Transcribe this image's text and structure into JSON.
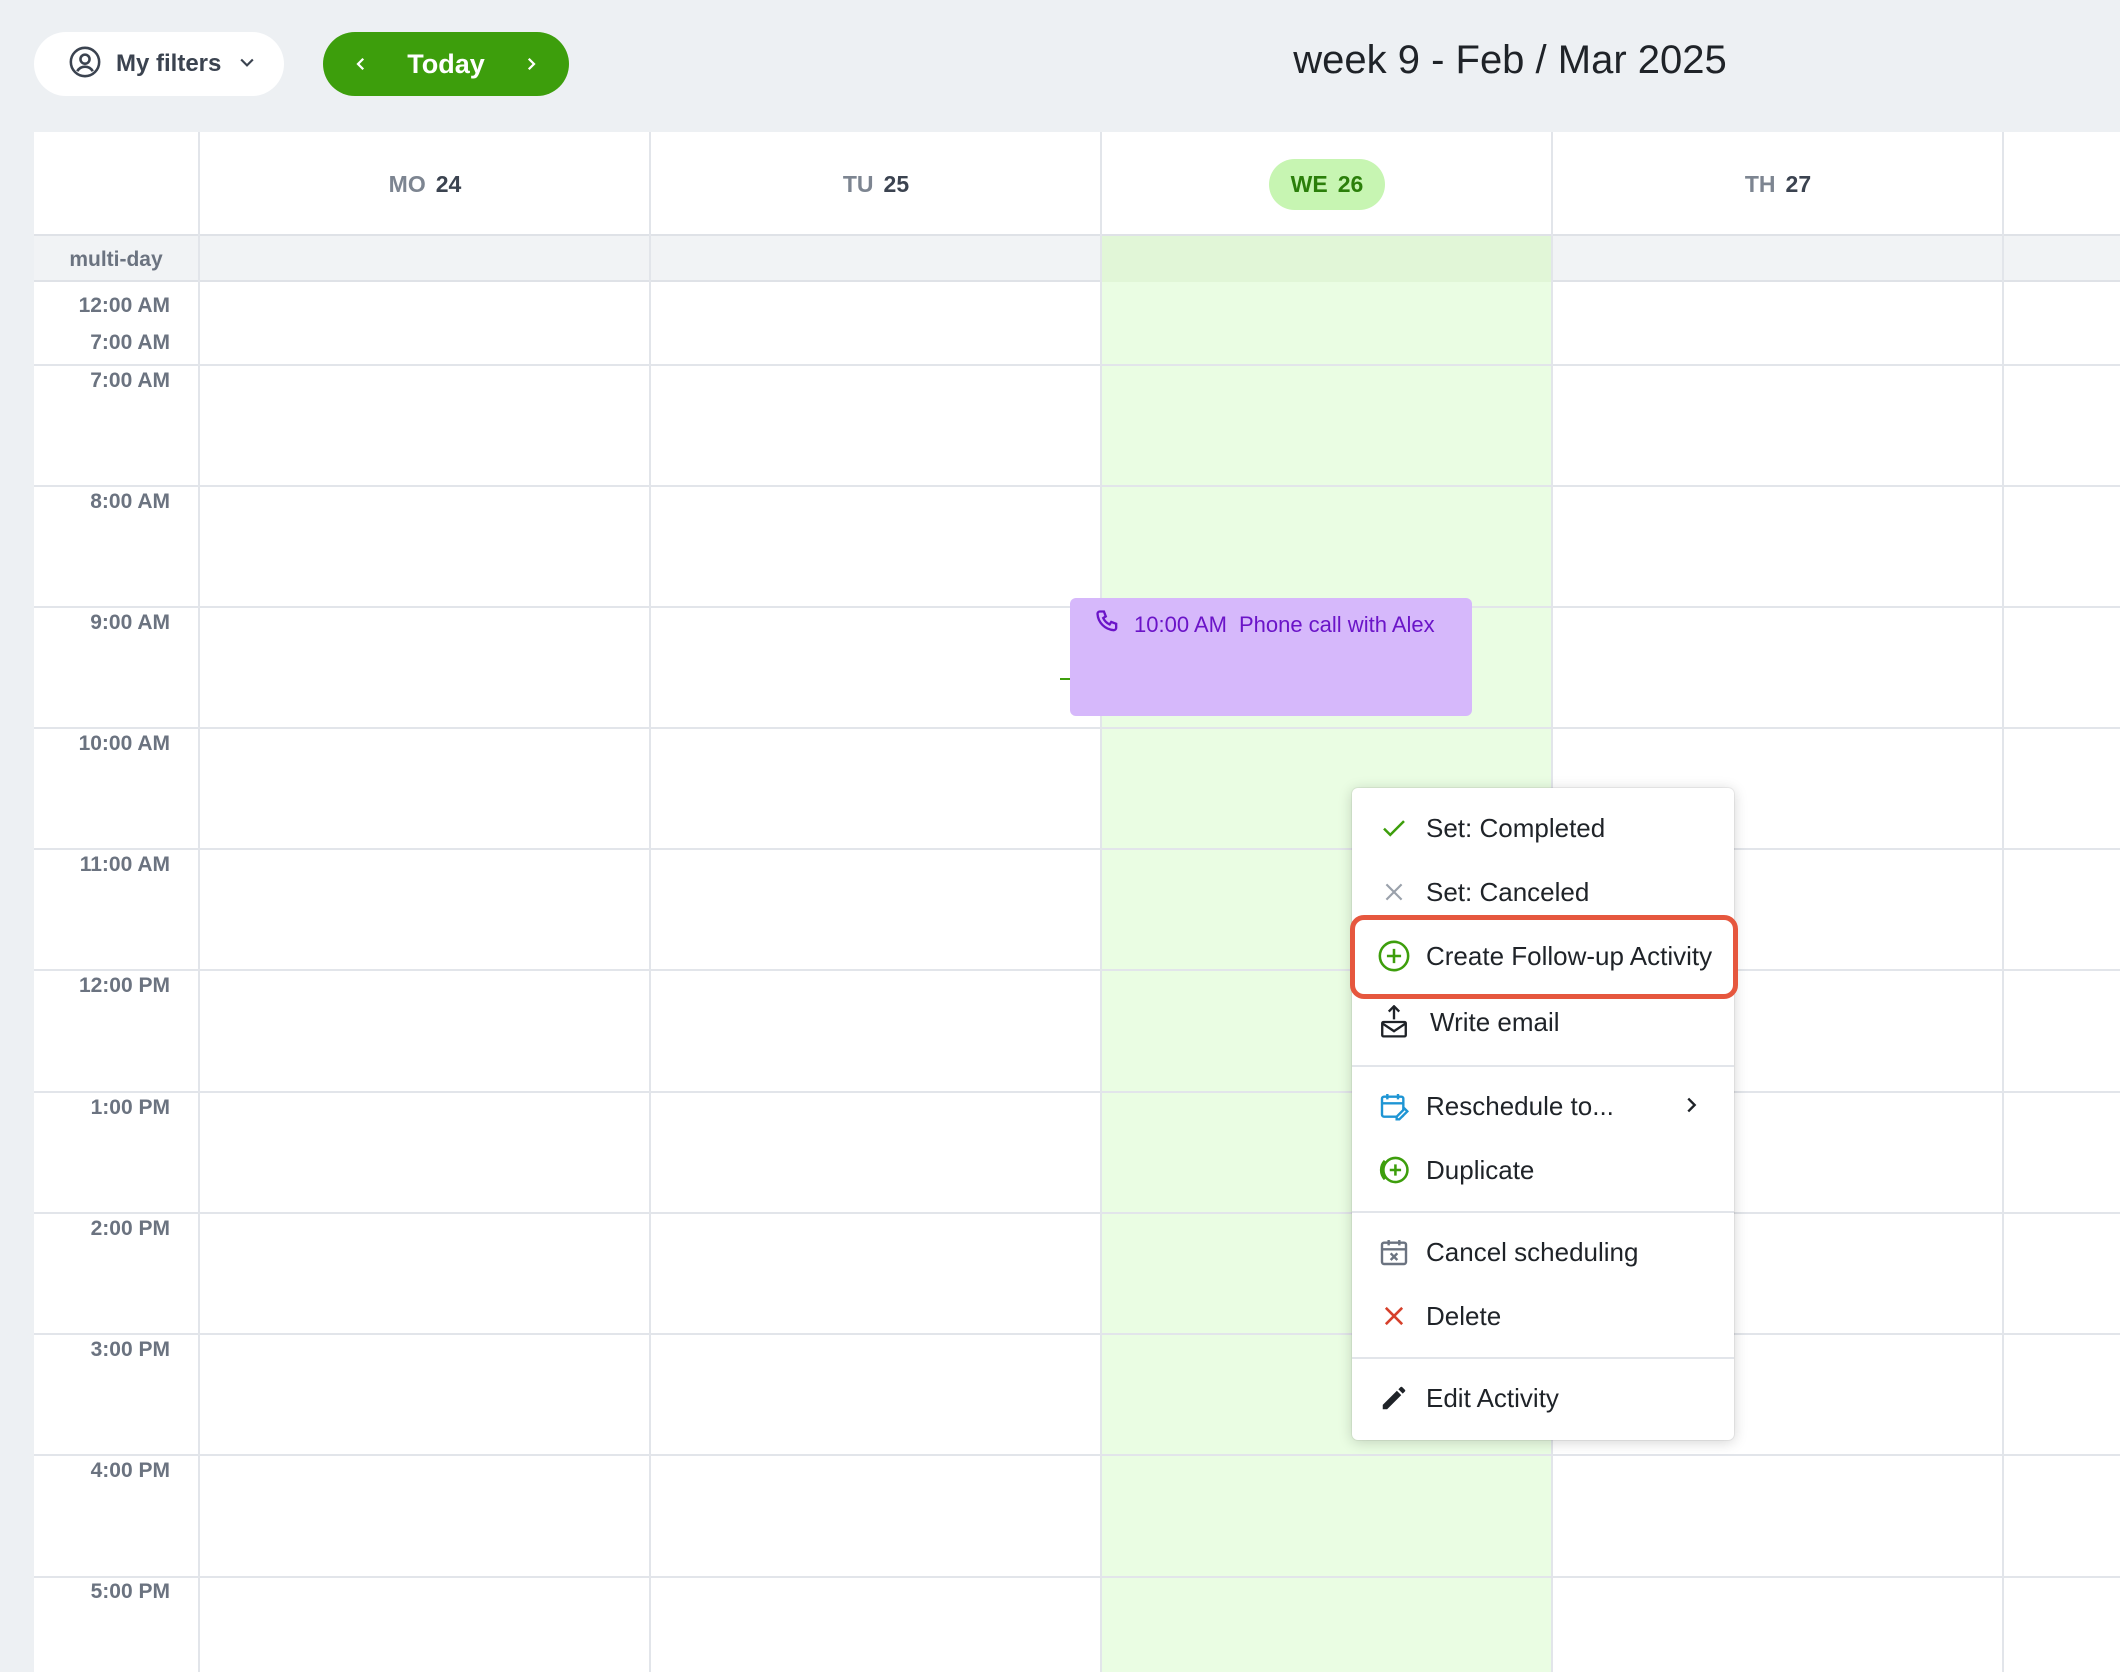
{
  "toolbar": {
    "filters_label": "My filters",
    "today_label": "Today",
    "week_title": "week 9 - Feb / Mar 2025"
  },
  "calendar": {
    "days": [
      {
        "dow": "MO",
        "date": "24"
      },
      {
        "dow": "TU",
        "date": "25"
      },
      {
        "dow": "WE",
        "date": "26",
        "current": true
      },
      {
        "dow": "TH",
        "date": "27"
      }
    ],
    "multiday_label": "multi-day",
    "time_labels": {
      "night_start": "12:00 AM",
      "night_end": "7:00 AM",
      "h7": "7:00 AM",
      "h8": "8:00 AM",
      "h9": "9:00 AM",
      "h10": "10:00 AM",
      "h11": "11:00 AM",
      "h12": "12:00 PM",
      "h13": "1:00 PM",
      "h14": "2:00 PM",
      "h15": "3:00 PM",
      "h16": "4:00 PM",
      "h17": "5:00 PM"
    }
  },
  "event": {
    "time": "10:00 AM",
    "title": "Phone call with Alex",
    "icon": "phone-icon",
    "color": "#d6b8fb"
  },
  "context_menu": {
    "items": [
      {
        "label": "Set: Completed",
        "icon": "check-icon"
      },
      {
        "label": "Set: Canceled",
        "icon": "x-icon"
      },
      {
        "label": "Create Follow-up Activity",
        "icon": "plus-circle-icon",
        "highlighted": true
      },
      {
        "label": "Write email",
        "icon": "email-export-icon"
      },
      {
        "label": "Reschedule to...",
        "icon": "calendar-edit-icon",
        "has_submenu": true
      },
      {
        "label": "Duplicate",
        "icon": "duplicate-icon"
      },
      {
        "label": "Cancel scheduling",
        "icon": "calendar-x-icon"
      },
      {
        "label": "Delete",
        "icon": "delete-icon"
      },
      {
        "label": "Edit Activity",
        "icon": "pencil-icon"
      }
    ]
  },
  "colors": {
    "accent": "#3d9e0c",
    "today_column": "#eafde3",
    "highlight_border": "#e6573e",
    "event_text": "#6b14c8"
  }
}
